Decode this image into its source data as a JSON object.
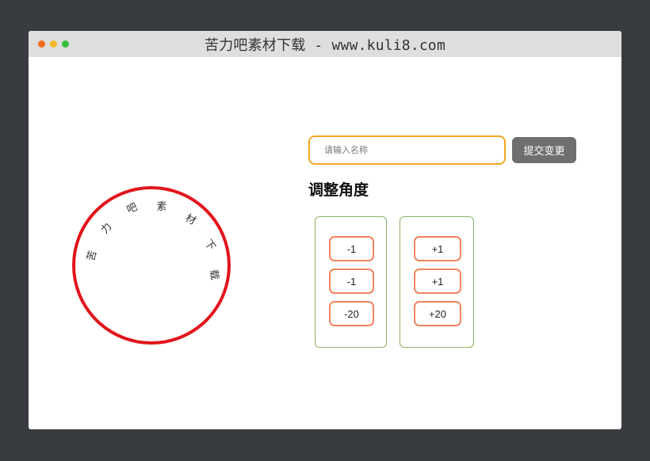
{
  "window": {
    "title": "苦力吧素材下载 - www.kuli8.com"
  },
  "seal": {
    "chars": [
      "苦",
      "力",
      "吧",
      "素",
      "材",
      "下",
      "载"
    ],
    "ring_color": "#e1141b"
  },
  "form": {
    "name_placeholder": "请输入名称",
    "name_value": "",
    "submit_label": "提交变更"
  },
  "angle": {
    "heading": "调整角度",
    "decrease_group": [
      "-1",
      "-1",
      "-20"
    ],
    "increase_group": [
      "+1",
      "+1",
      "+20"
    ]
  },
  "colors": {
    "input_border": "#f5a623",
    "button_border": "#f0845c",
    "group_border": "#8ab064",
    "submit_bg": "#6f6f6f"
  }
}
